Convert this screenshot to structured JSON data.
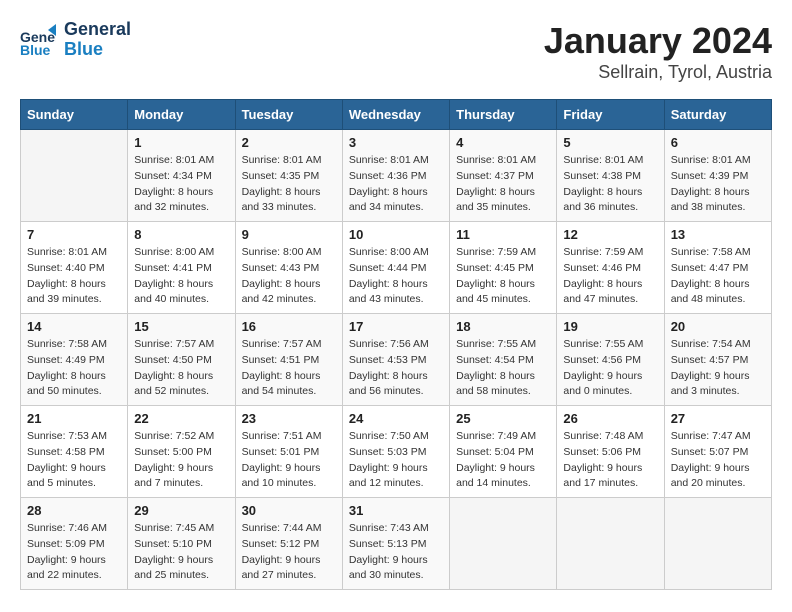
{
  "logo": {
    "line1": "General",
    "line2": "Blue"
  },
  "title": "January 2024",
  "subtitle": "Sellrain, Tyrol, Austria",
  "days_of_week": [
    "Sunday",
    "Monday",
    "Tuesday",
    "Wednesday",
    "Thursday",
    "Friday",
    "Saturday"
  ],
  "weeks": [
    [
      {
        "date": "",
        "info": ""
      },
      {
        "date": "1",
        "info": "Sunrise: 8:01 AM\nSunset: 4:34 PM\nDaylight: 8 hours\nand 32 minutes."
      },
      {
        "date": "2",
        "info": "Sunrise: 8:01 AM\nSunset: 4:35 PM\nDaylight: 8 hours\nand 33 minutes."
      },
      {
        "date": "3",
        "info": "Sunrise: 8:01 AM\nSunset: 4:36 PM\nDaylight: 8 hours\nand 34 minutes."
      },
      {
        "date": "4",
        "info": "Sunrise: 8:01 AM\nSunset: 4:37 PM\nDaylight: 8 hours\nand 35 minutes."
      },
      {
        "date": "5",
        "info": "Sunrise: 8:01 AM\nSunset: 4:38 PM\nDaylight: 8 hours\nand 36 minutes."
      },
      {
        "date": "6",
        "info": "Sunrise: 8:01 AM\nSunset: 4:39 PM\nDaylight: 8 hours\nand 38 minutes."
      }
    ],
    [
      {
        "date": "7",
        "info": "Sunrise: 8:01 AM\nSunset: 4:40 PM\nDaylight: 8 hours\nand 39 minutes."
      },
      {
        "date": "8",
        "info": "Sunrise: 8:00 AM\nSunset: 4:41 PM\nDaylight: 8 hours\nand 40 minutes."
      },
      {
        "date": "9",
        "info": "Sunrise: 8:00 AM\nSunset: 4:43 PM\nDaylight: 8 hours\nand 42 minutes."
      },
      {
        "date": "10",
        "info": "Sunrise: 8:00 AM\nSunset: 4:44 PM\nDaylight: 8 hours\nand 43 minutes."
      },
      {
        "date": "11",
        "info": "Sunrise: 7:59 AM\nSunset: 4:45 PM\nDaylight: 8 hours\nand 45 minutes."
      },
      {
        "date": "12",
        "info": "Sunrise: 7:59 AM\nSunset: 4:46 PM\nDaylight: 8 hours\nand 47 minutes."
      },
      {
        "date": "13",
        "info": "Sunrise: 7:58 AM\nSunset: 4:47 PM\nDaylight: 8 hours\nand 48 minutes."
      }
    ],
    [
      {
        "date": "14",
        "info": "Sunrise: 7:58 AM\nSunset: 4:49 PM\nDaylight: 8 hours\nand 50 minutes."
      },
      {
        "date": "15",
        "info": "Sunrise: 7:57 AM\nSunset: 4:50 PM\nDaylight: 8 hours\nand 52 minutes."
      },
      {
        "date": "16",
        "info": "Sunrise: 7:57 AM\nSunset: 4:51 PM\nDaylight: 8 hours\nand 54 minutes."
      },
      {
        "date": "17",
        "info": "Sunrise: 7:56 AM\nSunset: 4:53 PM\nDaylight: 8 hours\nand 56 minutes."
      },
      {
        "date": "18",
        "info": "Sunrise: 7:55 AM\nSunset: 4:54 PM\nDaylight: 8 hours\nand 58 minutes."
      },
      {
        "date": "19",
        "info": "Sunrise: 7:55 AM\nSunset: 4:56 PM\nDaylight: 9 hours\nand 0 minutes."
      },
      {
        "date": "20",
        "info": "Sunrise: 7:54 AM\nSunset: 4:57 PM\nDaylight: 9 hours\nand 3 minutes."
      }
    ],
    [
      {
        "date": "21",
        "info": "Sunrise: 7:53 AM\nSunset: 4:58 PM\nDaylight: 9 hours\nand 5 minutes."
      },
      {
        "date": "22",
        "info": "Sunrise: 7:52 AM\nSunset: 5:00 PM\nDaylight: 9 hours\nand 7 minutes."
      },
      {
        "date": "23",
        "info": "Sunrise: 7:51 AM\nSunset: 5:01 PM\nDaylight: 9 hours\nand 10 minutes."
      },
      {
        "date": "24",
        "info": "Sunrise: 7:50 AM\nSunset: 5:03 PM\nDaylight: 9 hours\nand 12 minutes."
      },
      {
        "date": "25",
        "info": "Sunrise: 7:49 AM\nSunset: 5:04 PM\nDaylight: 9 hours\nand 14 minutes."
      },
      {
        "date": "26",
        "info": "Sunrise: 7:48 AM\nSunset: 5:06 PM\nDaylight: 9 hours\nand 17 minutes."
      },
      {
        "date": "27",
        "info": "Sunrise: 7:47 AM\nSunset: 5:07 PM\nDaylight: 9 hours\nand 20 minutes."
      }
    ],
    [
      {
        "date": "28",
        "info": "Sunrise: 7:46 AM\nSunset: 5:09 PM\nDaylight: 9 hours\nand 22 minutes."
      },
      {
        "date": "29",
        "info": "Sunrise: 7:45 AM\nSunset: 5:10 PM\nDaylight: 9 hours\nand 25 minutes."
      },
      {
        "date": "30",
        "info": "Sunrise: 7:44 AM\nSunset: 5:12 PM\nDaylight: 9 hours\nand 27 minutes."
      },
      {
        "date": "31",
        "info": "Sunrise: 7:43 AM\nSunset: 5:13 PM\nDaylight: 9 hours\nand 30 minutes."
      },
      {
        "date": "",
        "info": ""
      },
      {
        "date": "",
        "info": ""
      },
      {
        "date": "",
        "info": ""
      }
    ]
  ]
}
